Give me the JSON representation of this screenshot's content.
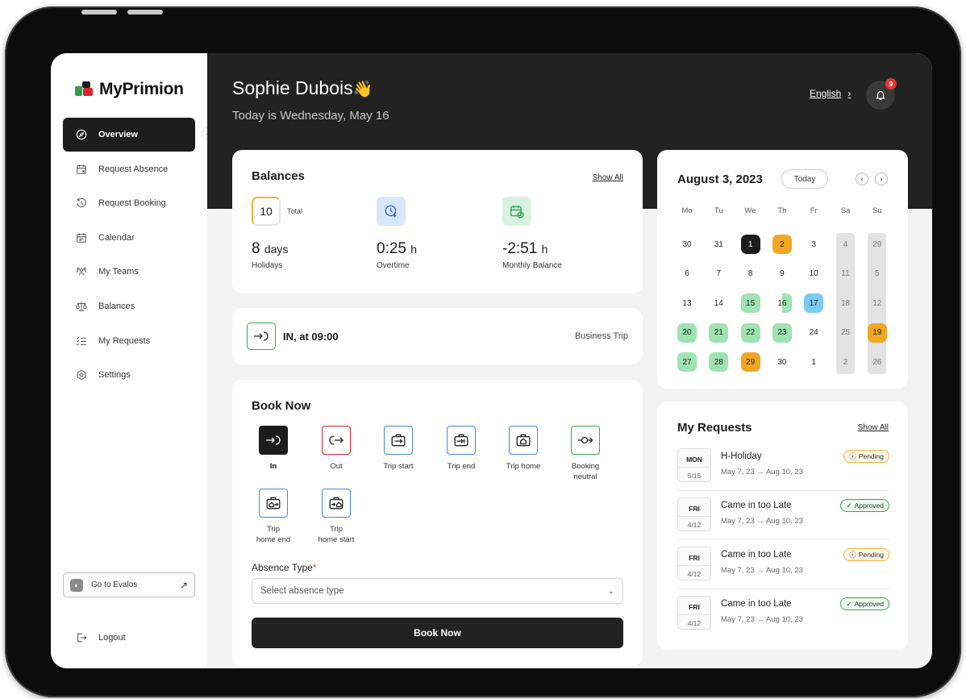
{
  "app": {
    "name": "MyPrimion"
  },
  "sidebar": {
    "items": [
      {
        "label": "Overview",
        "icon": "compass-icon",
        "active": true
      },
      {
        "label": "Request Absence",
        "icon": "calendar-x-icon"
      },
      {
        "label": "Request Booking",
        "icon": "clock-arrow-icon"
      },
      {
        "label": "Calendar",
        "icon": "calendar-icon"
      },
      {
        "label": "My Teams",
        "icon": "team-icon"
      },
      {
        "label": "Balances",
        "icon": "scale-icon"
      },
      {
        "label": "My Requests",
        "icon": "checklist-icon"
      },
      {
        "label": "Settings",
        "icon": "gear-icon"
      }
    ],
    "evalos_label": "Go to Evalos",
    "logout_label": "Logout"
  },
  "header": {
    "greeting": "Sophie Dubois",
    "greeting_emoji": "👋",
    "date_text": "Today is Wednesday, May 16",
    "language": "English",
    "notification_count": "9"
  },
  "balances": {
    "title": "Balances",
    "show_all": "Show All",
    "total_value": "10",
    "total_label": "Total",
    "holidays_value": "8",
    "holidays_unit": "days",
    "holidays_label": "Holidays",
    "overtime_value": "0:25",
    "overtime_unit": "h",
    "overtime_label": "Overtime",
    "monthly_value": "-2:51",
    "monthly_unit": "h",
    "monthly_label": "Monthly Balance"
  },
  "status": {
    "text": "IN, at 09:00",
    "trip": "Business Trip"
  },
  "book": {
    "title": "Book Now",
    "tiles": [
      {
        "label": "In",
        "line2": ""
      },
      {
        "label": "Out",
        "line2": ""
      },
      {
        "label": "Trip start",
        "line2": ""
      },
      {
        "label": "Trip end",
        "line2": ""
      },
      {
        "label": "Trip home",
        "line2": ""
      },
      {
        "label": "Booking",
        "line2": "neutral"
      },
      {
        "label": "Trip",
        "line2": "home end"
      },
      {
        "label": "Trip",
        "line2": "home start"
      }
    ],
    "absence_label": "Absence Type",
    "absence_required": "*",
    "absence_placeholder": "Select absence type",
    "button_label": "Book Now"
  },
  "calendar": {
    "title": "August 3, 2023",
    "today_label": "Today",
    "weekdays": [
      "Mo",
      "Tu",
      "We",
      "Th",
      "Fr",
      "Sa",
      "Su"
    ],
    "weeks": [
      [
        "30",
        "31",
        "1",
        "2",
        "3",
        "4",
        "29"
      ],
      [
        "6",
        "7",
        "8",
        "9",
        "10",
        "11",
        "5"
      ],
      [
        "13",
        "14",
        "15",
        "16",
        "17",
        "18",
        "12"
      ],
      [
        "20",
        "21",
        "22",
        "23",
        "24",
        "25",
        "19"
      ],
      [
        "27",
        "28",
        "29",
        "30",
        "1",
        "2",
        "26"
      ]
    ],
    "colors": {
      "selected": "#1c1c1c",
      "orange": "#f2a622",
      "green": "#9ee3b1",
      "blue": "#7ccaf2"
    }
  },
  "requests": {
    "title": "My Requests",
    "show_all": "Show All",
    "items": [
      {
        "day": "MON",
        "date": "5/15",
        "name": "H-Holiday",
        "range": "May 7, 23 → Aug 10, 23",
        "status": "Pending"
      },
      {
        "day": "FRI",
        "date": "4/12",
        "name": "Came in too Late",
        "range": "May 7, 23 → Aug 10, 23",
        "status": "Approved"
      },
      {
        "day": "FRI",
        "date": "4/12",
        "name": "Came in too Late",
        "range": "May 7, 23 → Aug 10, 23",
        "status": "Pending"
      },
      {
        "day": "FRI",
        "date": "4/12",
        "name": "Came in too Late",
        "range": "May 7, 23 → Aug 10, 23",
        "status": "Approved"
      }
    ]
  }
}
